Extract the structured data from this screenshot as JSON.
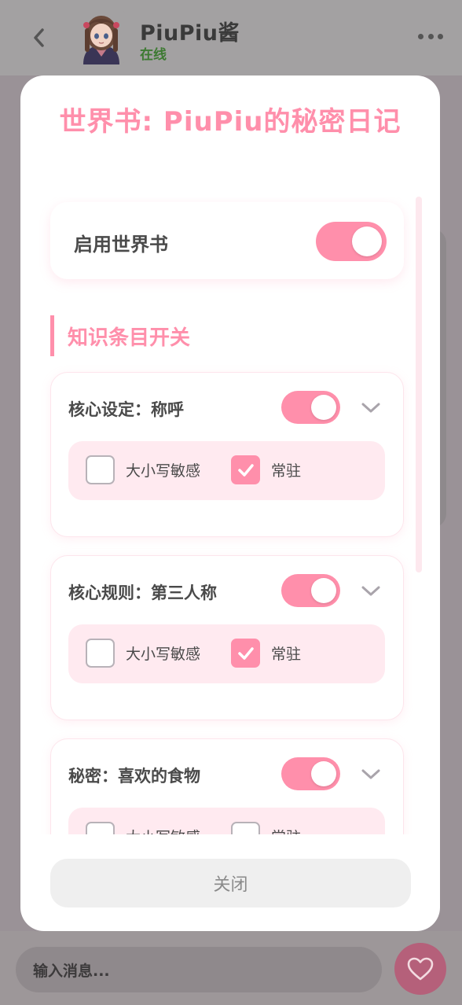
{
  "chat": {
    "name": "PiuPiu酱",
    "status": "在线",
    "input_placeholder": "输入消息..."
  },
  "modal": {
    "title": "世界书: PiuPiu的秘密日记",
    "master_toggle_label": "启用世界书",
    "master_enabled": true,
    "section_title": "知识条目开关",
    "entries": [
      {
        "title": "核心设定：称呼",
        "enabled": true,
        "case_sensitive_label": "大小写敏感",
        "case_sensitive": false,
        "constant_label": "常驻",
        "constant": true
      },
      {
        "title": "核心规则：第三人称",
        "enabled": true,
        "case_sensitive_label": "大小写敏感",
        "case_sensitive": false,
        "constant_label": "常驻",
        "constant": true
      },
      {
        "title": "秘密：喜欢的食物",
        "enabled": true,
        "case_sensitive_label": "大小写敏感",
        "case_sensitive": false,
        "constant_label": "常驻",
        "constant": false
      }
    ],
    "close_label": "关闭"
  },
  "colors": {
    "accent_pink": "#ff8fab",
    "option_bg": "#ffeaf0",
    "status_green": "#3d7a32",
    "overlay": "#9b9498"
  },
  "icons": [
    "back-arrow-icon",
    "more-icon",
    "heart-icon",
    "chevron-down-icon",
    "check-icon"
  ]
}
